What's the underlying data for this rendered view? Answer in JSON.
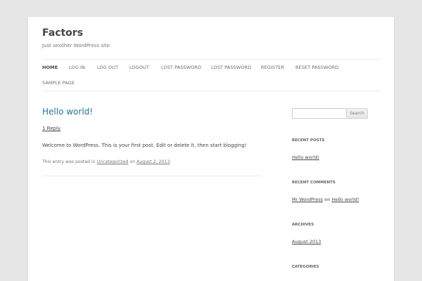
{
  "site": {
    "title": "Factors",
    "description": "Just another WordPress site"
  },
  "nav": {
    "items": [
      "Home",
      "Log in",
      "Log out",
      "Logout",
      "Lost Password",
      "Lost Password",
      "Register",
      "Reset Password",
      "Sample Page"
    ],
    "current": "Home"
  },
  "post": {
    "title": "Hello world!",
    "reply": "1 Reply",
    "content": "Welcome to WordPress. This is your first post. Edit or delete it, then start blogging!",
    "meta_prefix": "This entry was posted in",
    "category": "Uncategorized",
    "meta_on": "on",
    "date": "August 2, 2013",
    "meta_suffix": "."
  },
  "sidebar": {
    "search_button": "Search",
    "recent_posts_title": "Recent Posts",
    "recent_post": "Hello world!",
    "recent_comments_title": "Recent Comments",
    "comment_author": "Mr WordPress",
    "comment_on": "on",
    "comment_post": "Hello world!",
    "archives_title": "Archives",
    "archive": "August 2013",
    "categories_title": "Categories"
  },
  "colors": {
    "link": "#21759b",
    "background": "#e6e6e6",
    "page": "#ffffff"
  }
}
